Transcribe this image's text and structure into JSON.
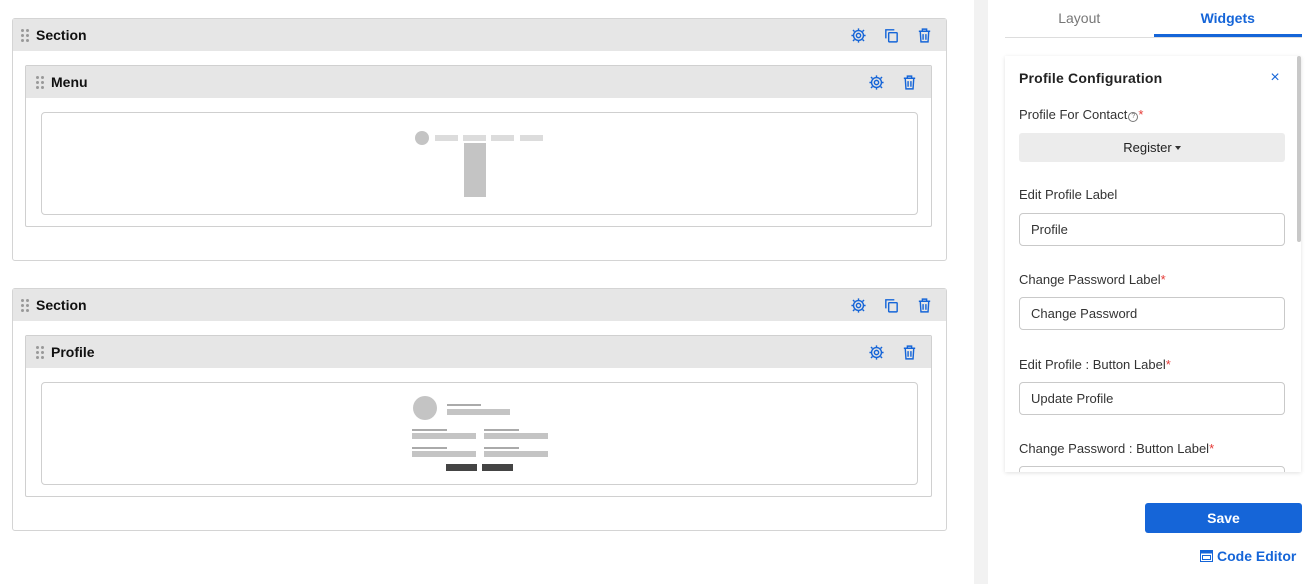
{
  "canvas": {
    "section1": {
      "title": "Section"
    },
    "menu_widget": {
      "title": "Menu"
    },
    "section2": {
      "title": "Section"
    },
    "profile_widget": {
      "title": "Profile"
    }
  },
  "panel": {
    "tabs": [
      {
        "label": "Layout",
        "active": false
      },
      {
        "label": "Widgets",
        "active": true
      }
    ],
    "config": {
      "title": "Profile Configuration",
      "close": "×",
      "profile_for_contact_label": "Profile For Contact",
      "profile_for_contact_value": "Register",
      "edit_profile_label": "Edit Profile Label",
      "edit_profile_value": "Profile",
      "change_password_label": "Change Password Label",
      "change_password_value": "Change Password",
      "edit_profile_button_label": "Edit Profile : Button Label",
      "edit_profile_button_value": "Update Profile",
      "change_password_button_label": "Change Password : Button Label",
      "required_mark": "*",
      "help_mark": "?"
    },
    "save_label": "Save",
    "code_editor_label": "Code Editor"
  },
  "colors": {
    "accent": "#1565d8",
    "required": "#e53935",
    "header_bg": "#e6e6e6"
  }
}
